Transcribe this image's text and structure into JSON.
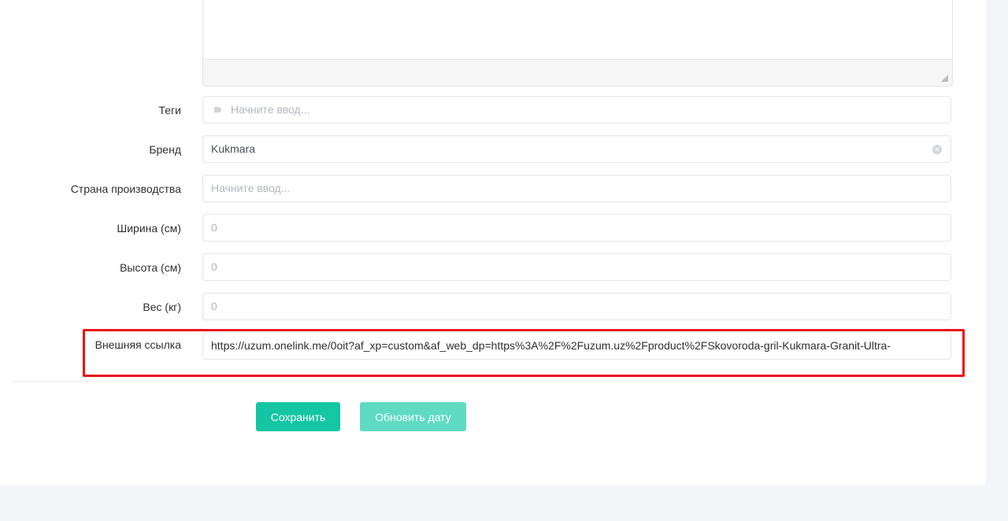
{
  "form": {
    "tags": {
      "label": "Теги",
      "placeholder": "Начните ввод..."
    },
    "brand": {
      "label": "Бренд",
      "value": "Kukmara"
    },
    "country": {
      "label": "Страна производства",
      "placeholder": "Начните ввод..."
    },
    "width": {
      "label": "Ширина (см)",
      "placeholder": "0"
    },
    "height": {
      "label": "Высота (см)",
      "placeholder": "0"
    },
    "weight": {
      "label": "Вес (кг)",
      "placeholder": "0"
    },
    "external_link": {
      "label": "Внешняя ссылка",
      "value": "https://uzum.onelink.me/0oit?af_xp=custom&af_web_dp=https%3A%2F%2Fuzum.uz%2Fproduct%2FSkovoroda-gril-Kukmara-Granit-Ultra-"
    }
  },
  "actions": {
    "save_label": "Сохранить",
    "update_date_label": "Обновить дату"
  },
  "colors": {
    "primary": "#14c6a4",
    "primary_light": "#5fdbc2",
    "highlight": "#e8141a"
  }
}
